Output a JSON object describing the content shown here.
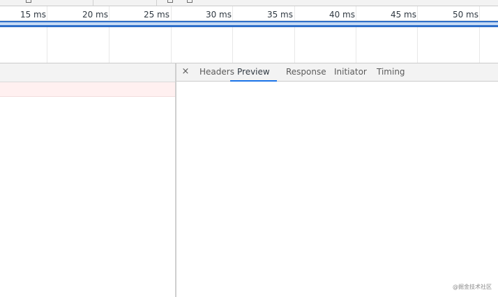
{
  "timeline": {
    "ticks": [
      "15 ms",
      "20 ms",
      "25 ms",
      "30 ms",
      "35 ms",
      "40 ms",
      "45 ms",
      "50 ms"
    ]
  },
  "details": {
    "close_label": "×",
    "tabs": [
      {
        "label": "Headers",
        "active": false
      },
      {
        "label": "Preview",
        "active": true
      },
      {
        "label": "Response",
        "active": false
      },
      {
        "label": "Initiator",
        "active": false
      },
      {
        "label": "Timing",
        "active": false
      }
    ]
  },
  "watermark": "@掘金技术社区",
  "colors": {
    "accent": "#1a73e8",
    "frame_line": "#2f6fc9",
    "selected_row": "#fff0f0"
  }
}
